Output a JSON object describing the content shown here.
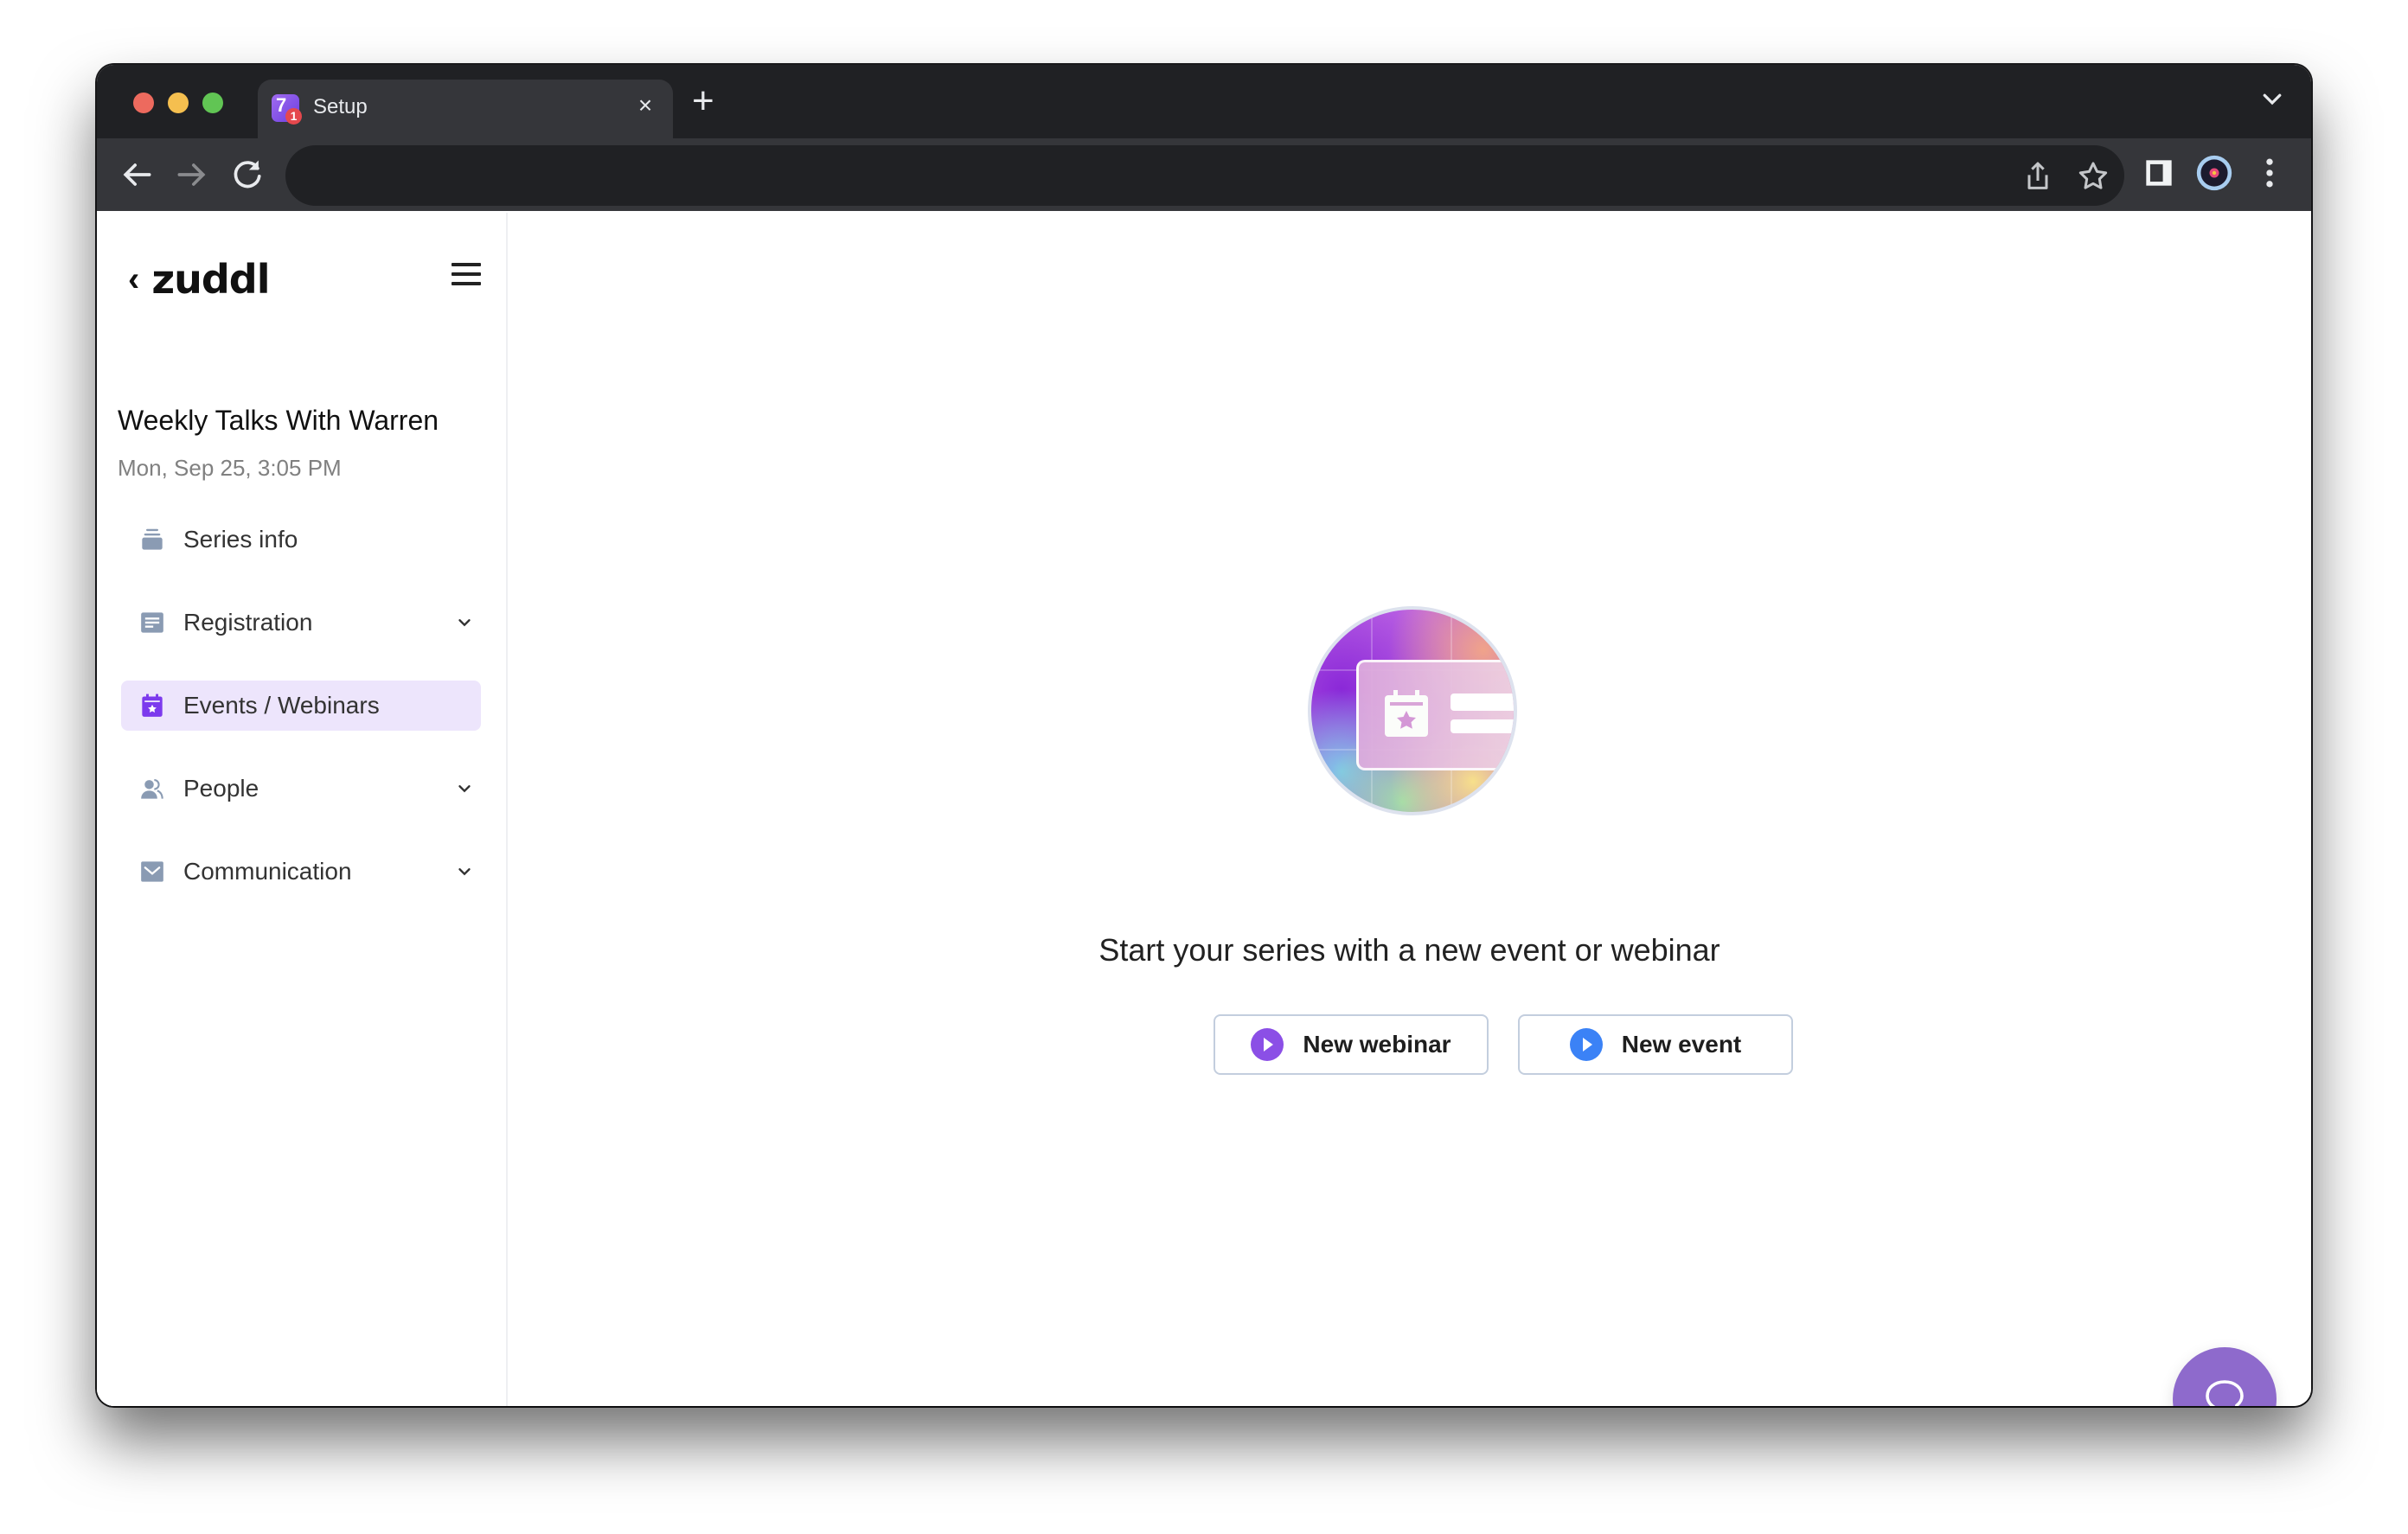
{
  "browser": {
    "tab": {
      "title": "Setup",
      "favicon_badge": "1",
      "favicon_glyph": "7"
    },
    "new_tab_label": "+",
    "close_tab_label": "×",
    "address": ""
  },
  "sidebar": {
    "brand": "zuddl",
    "back_label": "‹",
    "series_title": "Weekly Talks With Warren",
    "series_datetime": "Mon, Sep 25, 3:05 PM",
    "items": [
      {
        "label": "Series info",
        "icon": "stack-icon",
        "expandable": false,
        "active": false
      },
      {
        "label": "Registration",
        "icon": "form-icon",
        "expandable": true,
        "active": false
      },
      {
        "label": "Events / Webinars",
        "icon": "calendar-star-icon",
        "expandable": false,
        "active": true
      },
      {
        "label": "People",
        "icon": "people-icon",
        "expandable": true,
        "active": false
      },
      {
        "label": "Communication",
        "icon": "mail-icon",
        "expandable": true,
        "active": false
      }
    ]
  },
  "main": {
    "empty_state_title": "Start your series with a new event or webinar",
    "buttons": [
      {
        "label": "New webinar",
        "icon_color": "#8b4fe6"
      },
      {
        "label": "New event",
        "icon_color": "#3b82f6"
      }
    ]
  },
  "colors": {
    "accent": "#7c3aed",
    "active_nav_bg": "#ede5fc",
    "icon_gray": "#8a9bb3",
    "chat_fab": "#8e6acc"
  }
}
